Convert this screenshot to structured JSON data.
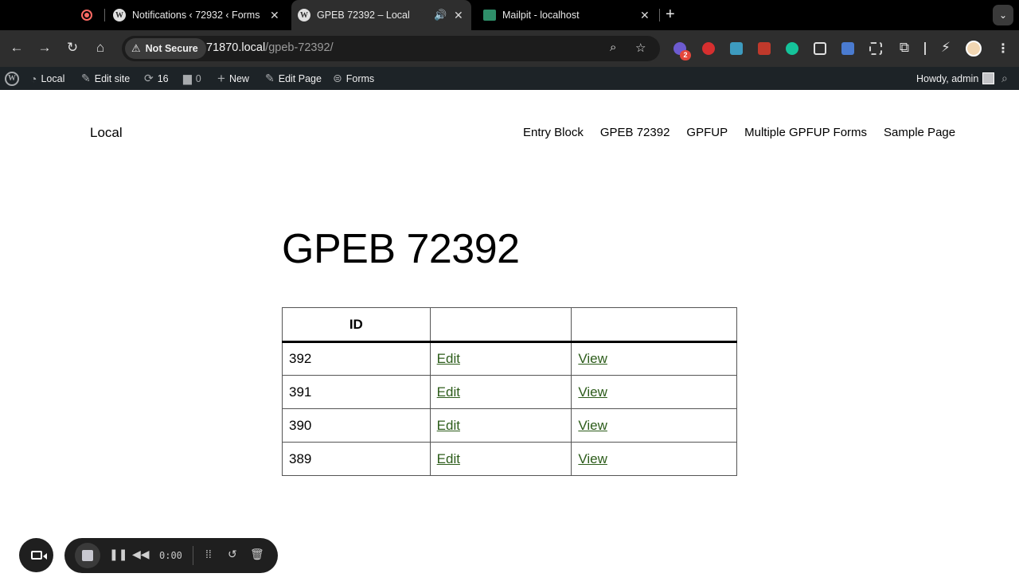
{
  "browser": {
    "tabs": [
      {
        "title": "Notifications ‹ 72932 ‹ Forms",
        "icon": "wordpress-icon",
        "active": false
      },
      {
        "title": "GPEB 72392 – Local",
        "icon": "wordpress-icon",
        "active": true,
        "audio": true
      },
      {
        "title": "Mailpit - localhost",
        "icon": "mailpit-icon",
        "active": false
      }
    ],
    "security_label": "Not Secure",
    "url_host": "71870.local",
    "url_path": "/gpeb-72392/",
    "extension_badge": "2"
  },
  "adminbar": {
    "site_name": "Local",
    "edit_site": "Edit site",
    "updates_count": "16",
    "comments_count": "0",
    "new_label": "New",
    "edit_page": "Edit Page",
    "forms": "Forms",
    "howdy": "Howdy, admin"
  },
  "site": {
    "title": "Local",
    "nav": [
      "Entry Block",
      "GPEB 72392",
      "GPFUP",
      "Multiple GPFUP Forms",
      "Sample Page"
    ]
  },
  "page": {
    "title": "GPEB 72392",
    "table": {
      "headers": [
        "ID",
        "",
        ""
      ],
      "rows": [
        {
          "id": "392",
          "edit": "Edit",
          "view": "View"
        },
        {
          "id": "391",
          "edit": "Edit",
          "view": "View"
        },
        {
          "id": "390",
          "edit": "Edit",
          "view": "View"
        },
        {
          "id": "389",
          "edit": "Edit",
          "view": "View"
        }
      ]
    }
  },
  "recorder": {
    "time": "0:00"
  },
  "colors": {
    "link": "#2c5c1a",
    "adminbar_bg": "#1d2327",
    "tabstrip_bg": "#000000",
    "toolbar_bg": "#2e2e2e"
  }
}
